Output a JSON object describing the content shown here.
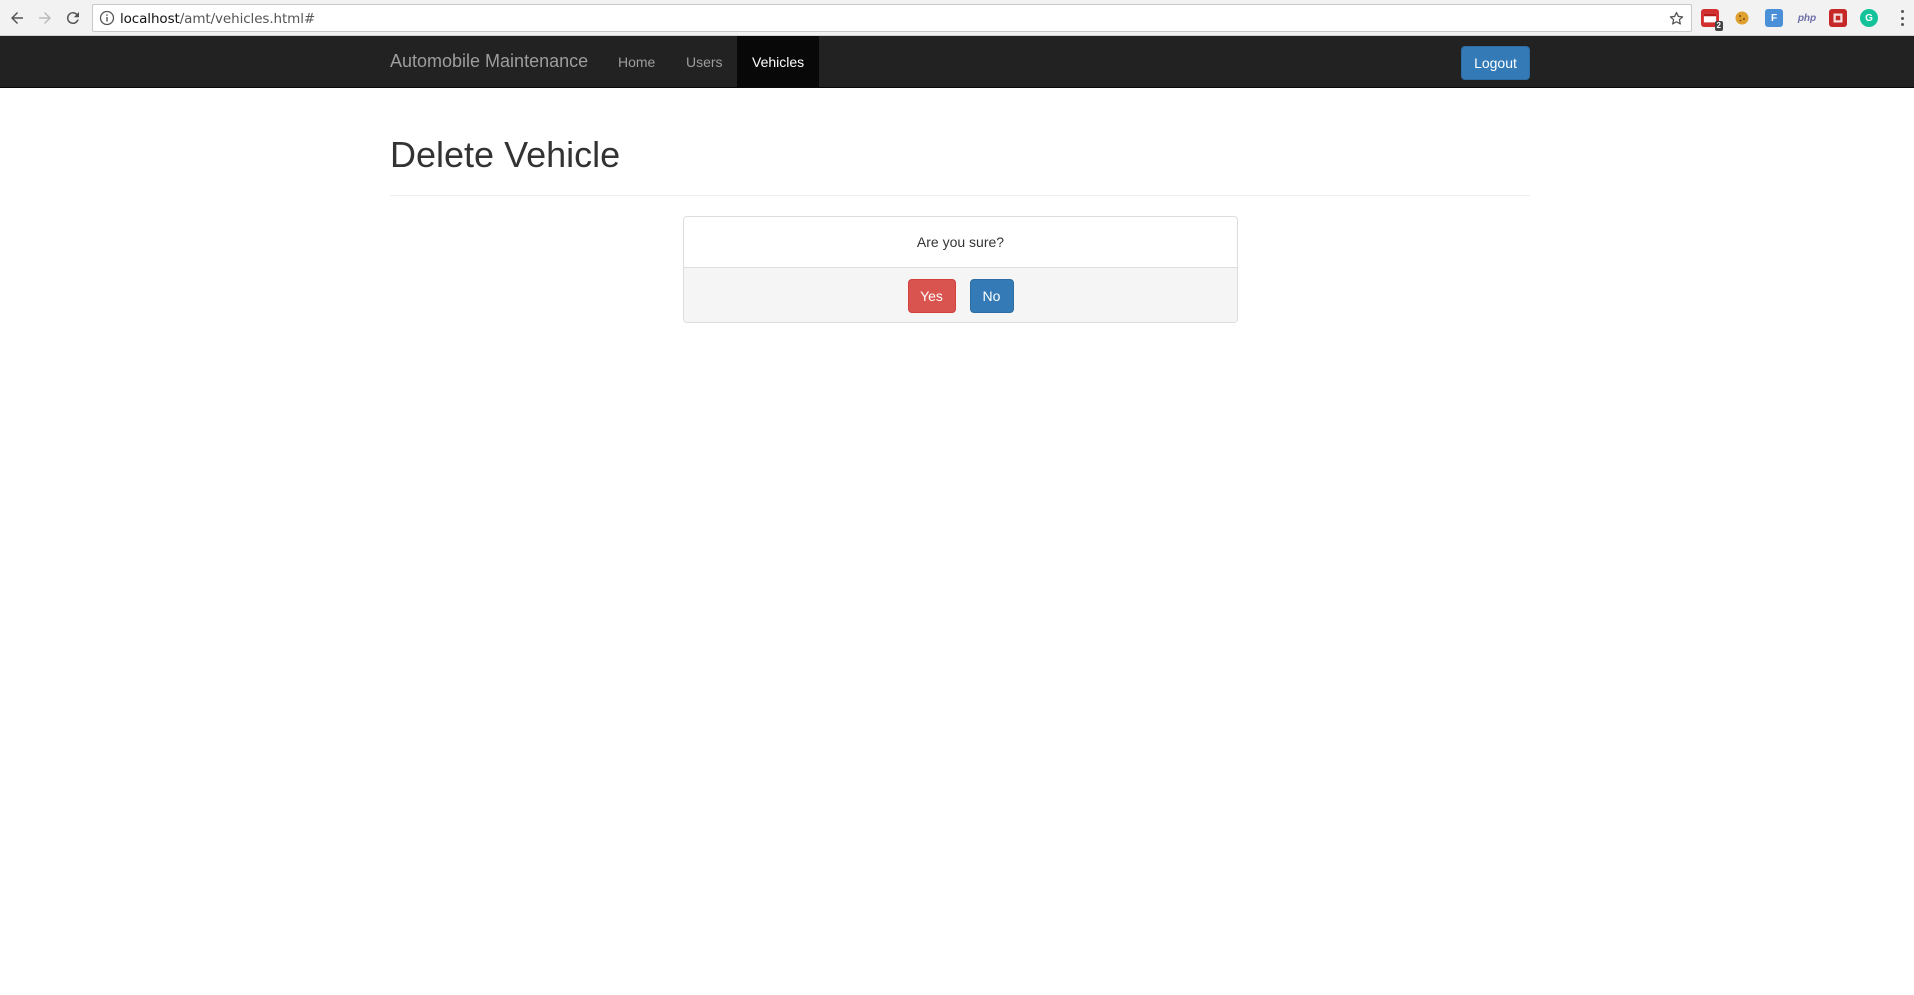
{
  "browser": {
    "url_host": "localhost",
    "url_path": "/amt/vehicles.html#",
    "extensions": [
      {
        "icon": "mail-ext-icon",
        "color": "#d32f2f",
        "badge": "2"
      },
      {
        "icon": "cookie-ext-icon",
        "color": "#e0a030"
      },
      {
        "icon": "f-ext-icon",
        "color": "#4a90d9",
        "text": "F"
      },
      {
        "icon": "php-ext-icon",
        "color": "#6c6fa8",
        "text": "php"
      },
      {
        "icon": "red-square-ext-icon",
        "color": "#c62828"
      },
      {
        "icon": "grammarly-ext-icon",
        "color": "#15c39a",
        "text": "G"
      }
    ]
  },
  "navbar": {
    "brand": "Automobile Maintenance",
    "links": [
      {
        "label": "Home",
        "active": false
      },
      {
        "label": "Users",
        "active": false
      },
      {
        "label": "Vehicles",
        "active": true
      }
    ],
    "logout_label": "Logout"
  },
  "page": {
    "title": "Delete Vehicle"
  },
  "confirm": {
    "message": "Are you sure?",
    "yes_label": "Yes",
    "no_label": "No"
  },
  "colors": {
    "navbar_bg": "#222222",
    "primary": "#337ab7",
    "danger": "#d9534f"
  }
}
